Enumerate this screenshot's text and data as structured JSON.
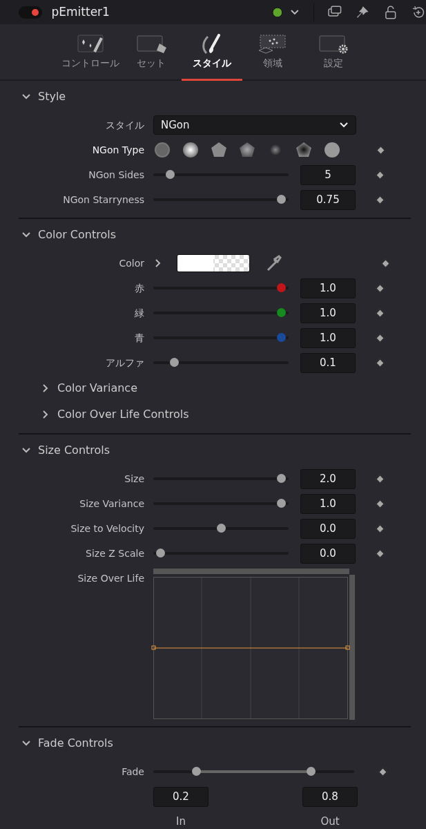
{
  "header": {
    "title": "pEmitter1",
    "enabled": true
  },
  "tabs": [
    {
      "label": "コントロール",
      "selected": false
    },
    {
      "label": "セット",
      "selected": false
    },
    {
      "label": "スタイル",
      "selected": true
    },
    {
      "label": "領域",
      "selected": false
    },
    {
      "label": "設定",
      "selected": false
    }
  ],
  "sections": [
    {
      "title": "Style",
      "expanded": true,
      "rows": [
        {
          "kind": "dropdown",
          "label": "スタイル",
          "value": "NGon"
        },
        {
          "kind": "shapes",
          "label": "NGon Type",
          "highlighted": true
        },
        {
          "kind": "slider",
          "label": "NGon Sides",
          "level": 0.1,
          "value": "5"
        },
        {
          "kind": "slider",
          "label": "NGon Starryness",
          "level": 0.98,
          "value": "0.75"
        }
      ]
    },
    {
      "title": "Color Controls",
      "expanded": true,
      "rows": [
        {
          "kind": "color",
          "label": "Color"
        },
        {
          "kind": "slider",
          "label": "赤",
          "level": 0.98,
          "value": "1.0",
          "color": "#c0161a"
        },
        {
          "kind": "slider",
          "label": "緑",
          "level": 0.98,
          "value": "1.0",
          "color": "#168a1e"
        },
        {
          "kind": "slider",
          "label": "青",
          "level": 0.98,
          "value": "1.0",
          "color": "#1a4b9a"
        },
        {
          "kind": "slider",
          "label": "アルファ",
          "level": 0.13,
          "value": "0.1"
        },
        {
          "kind": "subsection",
          "label": "Color Variance",
          "expanded": false
        },
        {
          "kind": "subsection",
          "label": "Color Over Life Controls",
          "expanded": false
        }
      ]
    },
    {
      "title": "Size Controls",
      "expanded": true,
      "rows": [
        {
          "kind": "slider",
          "label": "Size",
          "level": 0.98,
          "value": "2.0"
        },
        {
          "kind": "slider",
          "label": "Size Variance",
          "level": 0.98,
          "value": "1.0"
        },
        {
          "kind": "slider",
          "label": "Size to Velocity",
          "level": 0.5,
          "value": "0.0"
        },
        {
          "kind": "slider",
          "label": "Size Z Scale",
          "level": 0.02,
          "value": "0.0"
        },
        {
          "kind": "curve",
          "label": "Size Over Life"
        }
      ]
    },
    {
      "title": "Fade Controls",
      "expanded": true,
      "rows": [
        {
          "kind": "range",
          "label": "Fade",
          "in": {
            "level": 0.2,
            "value": "0.2",
            "caption": "In"
          },
          "out": {
            "level": 0.8,
            "value": "0.8",
            "caption": "Out"
          }
        }
      ]
    }
  ]
}
